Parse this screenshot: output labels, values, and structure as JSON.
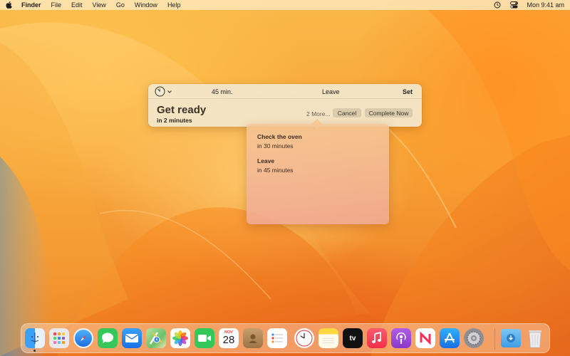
{
  "menubar": {
    "app": "Finder",
    "menus": [
      "File",
      "Edit",
      "View",
      "Go",
      "Window",
      "Help"
    ],
    "clock": "Mon 9:41 am"
  },
  "timer": {
    "duration": "45 min.",
    "name_value": "Leave",
    "set_label": "Set",
    "title": "Get ready",
    "subtitle": "in 2 minutes",
    "more_label": "2 More...",
    "cancel_label": "Cancel",
    "complete_label": "Complete Now"
  },
  "popover": {
    "items": [
      {
        "name": "Check the oven",
        "time": "in 30 minutes"
      },
      {
        "name": "Leave",
        "time": "in 45 minutes"
      }
    ]
  },
  "dock": {
    "apps": [
      {
        "name": "finder",
        "icon": "finder-icon",
        "color": "#2f8cf0"
      },
      {
        "name": "launchpad",
        "icon": "launchpad-icon",
        "color": "#e8e8ee"
      },
      {
        "name": "safari",
        "icon": "safari-icon",
        "color": "#2a8af0"
      },
      {
        "name": "messages",
        "icon": "messages-icon",
        "color": "#35c759"
      },
      {
        "name": "mail",
        "icon": "mail-icon",
        "color": "#1f8af5"
      },
      {
        "name": "maps",
        "icon": "maps-icon",
        "color": "#6cc06a"
      },
      {
        "name": "photos",
        "icon": "photos-icon",
        "color": "#ffffff"
      },
      {
        "name": "facetime",
        "icon": "facetime-icon",
        "color": "#34c759"
      },
      {
        "name": "calendar",
        "icon": "calendar-icon",
        "color": "#ffffff"
      },
      {
        "name": "contacts",
        "icon": "contacts-icon",
        "color": "#b08a5a"
      },
      {
        "name": "reminders",
        "icon": "reminders-icon",
        "color": "#ffffff"
      },
      {
        "name": "clock",
        "icon": "clock-icon",
        "color": "#ffffff"
      },
      {
        "name": "notes",
        "icon": "notes-icon",
        "color": "#ffd740"
      },
      {
        "name": "tv",
        "icon": "tv-icon",
        "color": "#111111"
      },
      {
        "name": "music",
        "icon": "music-icon",
        "color": "#fb3b55"
      },
      {
        "name": "podcasts",
        "icon": "podcasts-icon",
        "color": "#9b4fd6"
      },
      {
        "name": "news",
        "icon": "news-icon",
        "color": "#ffffff"
      },
      {
        "name": "app-store",
        "icon": "app-store-icon",
        "color": "#1d8cf5"
      },
      {
        "name": "system-settings",
        "icon": "settings-icon",
        "color": "#8e8e93"
      },
      {
        "name": "downloads",
        "icon": "downloads-folder-icon",
        "color": "#4aa5e8"
      },
      {
        "name": "trash",
        "icon": "trash-icon",
        "color": "#e8e8ea"
      }
    ],
    "calendar_month": "NOV",
    "calendar_day": "28",
    "tv_label": "tv"
  }
}
